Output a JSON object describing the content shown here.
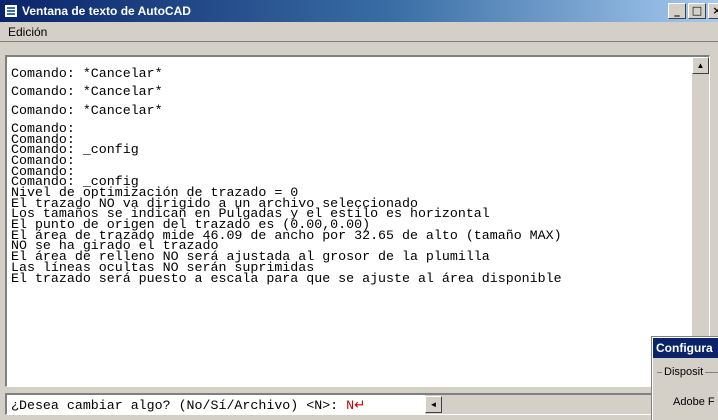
{
  "window": {
    "title": "Ventana de texto de AutoCAD",
    "controls": [
      "_",
      "□",
      "×"
    ]
  },
  "menu": [
    "Edición"
  ],
  "history": [
    {
      "text": "Comando: *Cancelar*",
      "gap": true
    },
    {
      "text": "Comando: *Cancelar*",
      "gap": true
    },
    {
      "text": "Comando: *Cancelar*",
      "gap": true
    },
    {
      "text": "Comando:",
      "gap": false
    },
    {
      "text": "Comando:",
      "gap": false
    },
    {
      "text": "Comando: _config",
      "gap": false
    },
    {
      "text": "Comando:",
      "gap": false
    },
    {
      "text": "Comando:",
      "gap": false
    },
    {
      "text": "Comando: _config",
      "gap": false
    },
    {
      "text": "Nivel de optimización de trazado = 0",
      "gap": false
    },
    {
      "text": "El trazado NO va dirigido a un archivo seleccionado",
      "gap": false
    },
    {
      "text": "Los tamaños se indican en Pulgadas y el estilo es horizontal",
      "gap": false
    },
    {
      "text": "El punto de origen del trazado es (0.00,0.00)",
      "gap": false
    },
    {
      "text": "El área de trazado mide 46.09 de ancho por 32.65 de alto (tamaño MAX)",
      "gap": false
    },
    {
      "text": "NO se ha girado el trazado",
      "gap": false
    },
    {
      "text": "El área de relleno NO será ajustada al grosor de la plumilla",
      "gap": false
    },
    {
      "text": "Las líneas ocultas NO serán suprimidas",
      "gap": false
    },
    {
      "text": "El trazado será puesto a escala para que se ajuste al área disponible",
      "gap": false
    }
  ],
  "command": {
    "prompt": "¿Desea cambiar algo? (No/Sí/Archivo) <N>: ",
    "input": "N↵"
  },
  "scrollbar": {
    "up": "▲",
    "left": "◄"
  },
  "dialog": {
    "title": "Configura",
    "group_label": "Disposit",
    "device_text": "Adobe F"
  }
}
